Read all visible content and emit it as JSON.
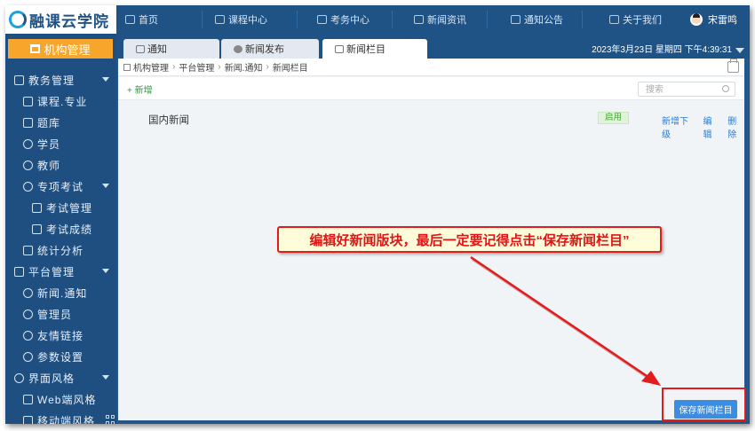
{
  "app": {
    "logo_text": "融课云学院"
  },
  "topnav": [
    {
      "label": "首页",
      "icon": "home-icon"
    },
    {
      "label": "课程中心",
      "icon": "course-icon"
    },
    {
      "label": "考务中心",
      "icon": "exam-icon"
    },
    {
      "label": "新闻资讯",
      "icon": "news-icon"
    },
    {
      "label": "通知公告",
      "icon": "notice-icon"
    },
    {
      "label": "关于我们",
      "icon": "about-icon"
    }
  ],
  "user": {
    "name": "宋雷鸣"
  },
  "sidebar": {
    "header": "机构管理",
    "items": [
      {
        "label": "教务管理",
        "icon": "chart-icon"
      },
      {
        "label": "课程.专业",
        "icon": "book-icon"
      },
      {
        "label": "题库",
        "icon": "question-bank-icon"
      },
      {
        "label": "学员",
        "icon": "student-icon"
      },
      {
        "label": "教师",
        "icon": "teacher-icon"
      },
      {
        "label": "专项考试",
        "icon": "target-icon"
      },
      {
        "label": "考试管理",
        "icon": "exam-manage-icon"
      },
      {
        "label": "考试成绩",
        "icon": "score-icon"
      },
      {
        "label": "统计分析",
        "icon": "stats-icon"
      },
      {
        "label": "平台管理",
        "icon": "platform-icon"
      },
      {
        "label": "新闻.通知",
        "icon": "news-notice-icon"
      },
      {
        "label": "管理员",
        "icon": "admin-icon"
      },
      {
        "label": "友情链接",
        "icon": "link-icon"
      },
      {
        "label": "参数设置",
        "icon": "settings-icon"
      },
      {
        "label": "界面风格",
        "icon": "ui-icon"
      },
      {
        "label": "Web端风格",
        "icon": "monitor-icon"
      },
      {
        "label": "移动端风格",
        "icon": "mobile-icon"
      }
    ]
  },
  "tabs": [
    {
      "label": "通知"
    },
    {
      "label": "新闻发布"
    },
    {
      "label": "新闻栏目"
    }
  ],
  "datetime": "2023年3月23日 星期四 下午4:39:31",
  "breadcrumb": [
    "机构管理",
    "平台管理",
    "新闻.通知",
    "新闻栏目"
  ],
  "toolbar": {
    "add_label": "+ 新增",
    "search_placeholder": "搜索"
  },
  "row": {
    "title": "国内新闻",
    "status": "启用",
    "actions": [
      "新增下级",
      "编辑",
      "删除"
    ]
  },
  "save_button": "保存新闻栏目",
  "annotation": {
    "text": "编辑好新闻版块，最后一定要记得点击“保存新闻栏目”",
    "color": "#e21c1c"
  }
}
